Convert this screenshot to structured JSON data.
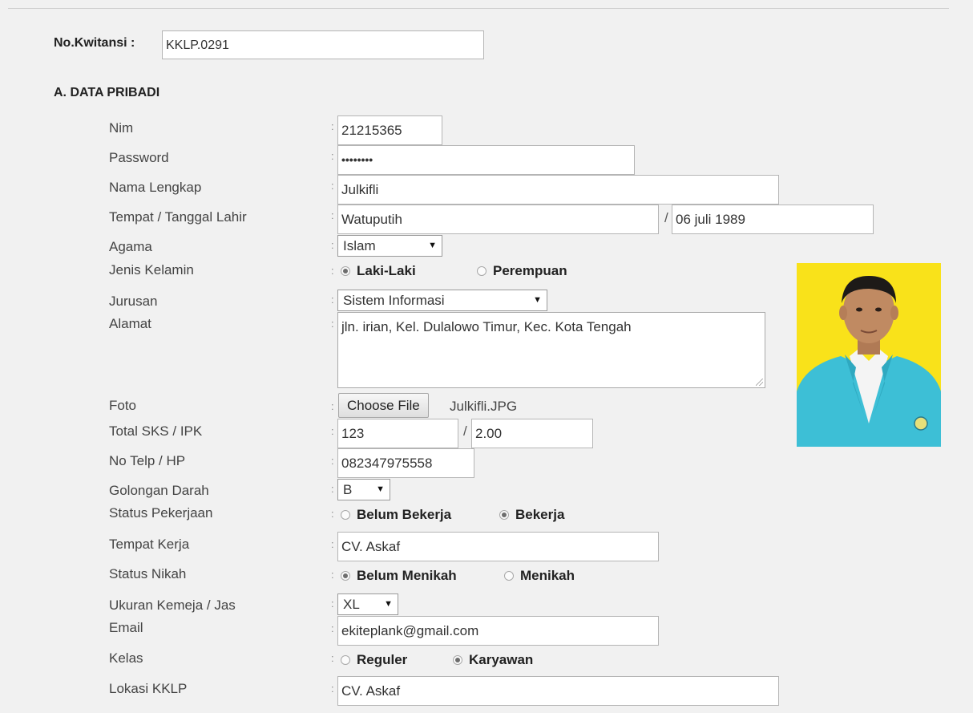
{
  "header": {
    "kwitansi_label": "No.Kwitansi :",
    "kwitansi_value": "KKLP.0291"
  },
  "section_title": "A. DATA PRIBADI",
  "colon": ":",
  "slash": "/",
  "fields": {
    "nim": {
      "label": "Nim",
      "value": "21215365"
    },
    "password": {
      "label": "Password",
      "value": "••••••••"
    },
    "nama_lengkap": {
      "label": "Nama Lengkap",
      "value": "Julkifli"
    },
    "ttl": {
      "label": "Tempat / Tanggal Lahir",
      "tempat": "Watuputih",
      "tanggal": "06 juli 1989"
    },
    "agama": {
      "label": "Agama",
      "value": "Islam"
    },
    "jenis_kelamin": {
      "label": "Jenis Kelamin",
      "options": [
        "Laki-Laki",
        "Perempuan"
      ],
      "selected": "Laki-Laki"
    },
    "jurusan": {
      "label": "Jurusan",
      "value": "Sistem Informasi"
    },
    "alamat": {
      "label": "Alamat",
      "value": "jln. irian, Kel. Dulalowo Timur, Kec. Kota Tengah"
    },
    "foto": {
      "label": "Foto",
      "button": "Choose File",
      "filename": "Julkifli.JPG"
    },
    "sks_ipk": {
      "label": "Total SKS / IPK",
      "sks": "123",
      "ipk": "2.00"
    },
    "telp": {
      "label": "No Telp / HP",
      "value": "082347975558"
    },
    "golongan_darah": {
      "label": "Golongan Darah",
      "value": "B"
    },
    "status_pekerjaan": {
      "label": "Status Pekerjaan",
      "options": [
        "Belum Bekerja",
        "Bekerja"
      ],
      "selected": "Bekerja"
    },
    "tempat_kerja": {
      "label": "Tempat Kerja",
      "value": "CV. Askaf"
    },
    "status_nikah": {
      "label": "Status Nikah",
      "options": [
        "Belum Menikah",
        "Menikah"
      ],
      "selected": "Belum Menikah"
    },
    "ukuran": {
      "label": "Ukuran Kemeja / Jas",
      "value": "XL"
    },
    "email": {
      "label": "Email",
      "value": "ekiteplank@gmail.com"
    },
    "kelas": {
      "label": "Kelas",
      "options": [
        "Reguler",
        "Karyawan"
      ],
      "selected": "Karyawan"
    },
    "lokasi_kklp": {
      "label": "Lokasi KKLP",
      "value": "CV. Askaf"
    }
  },
  "colors": {
    "photo_background": "#f9e21a",
    "shirt": "#3dbfd6"
  },
  "icons": {
    "select_arrow": "dropdown-arrow-icon",
    "radio": "radio-icon"
  }
}
